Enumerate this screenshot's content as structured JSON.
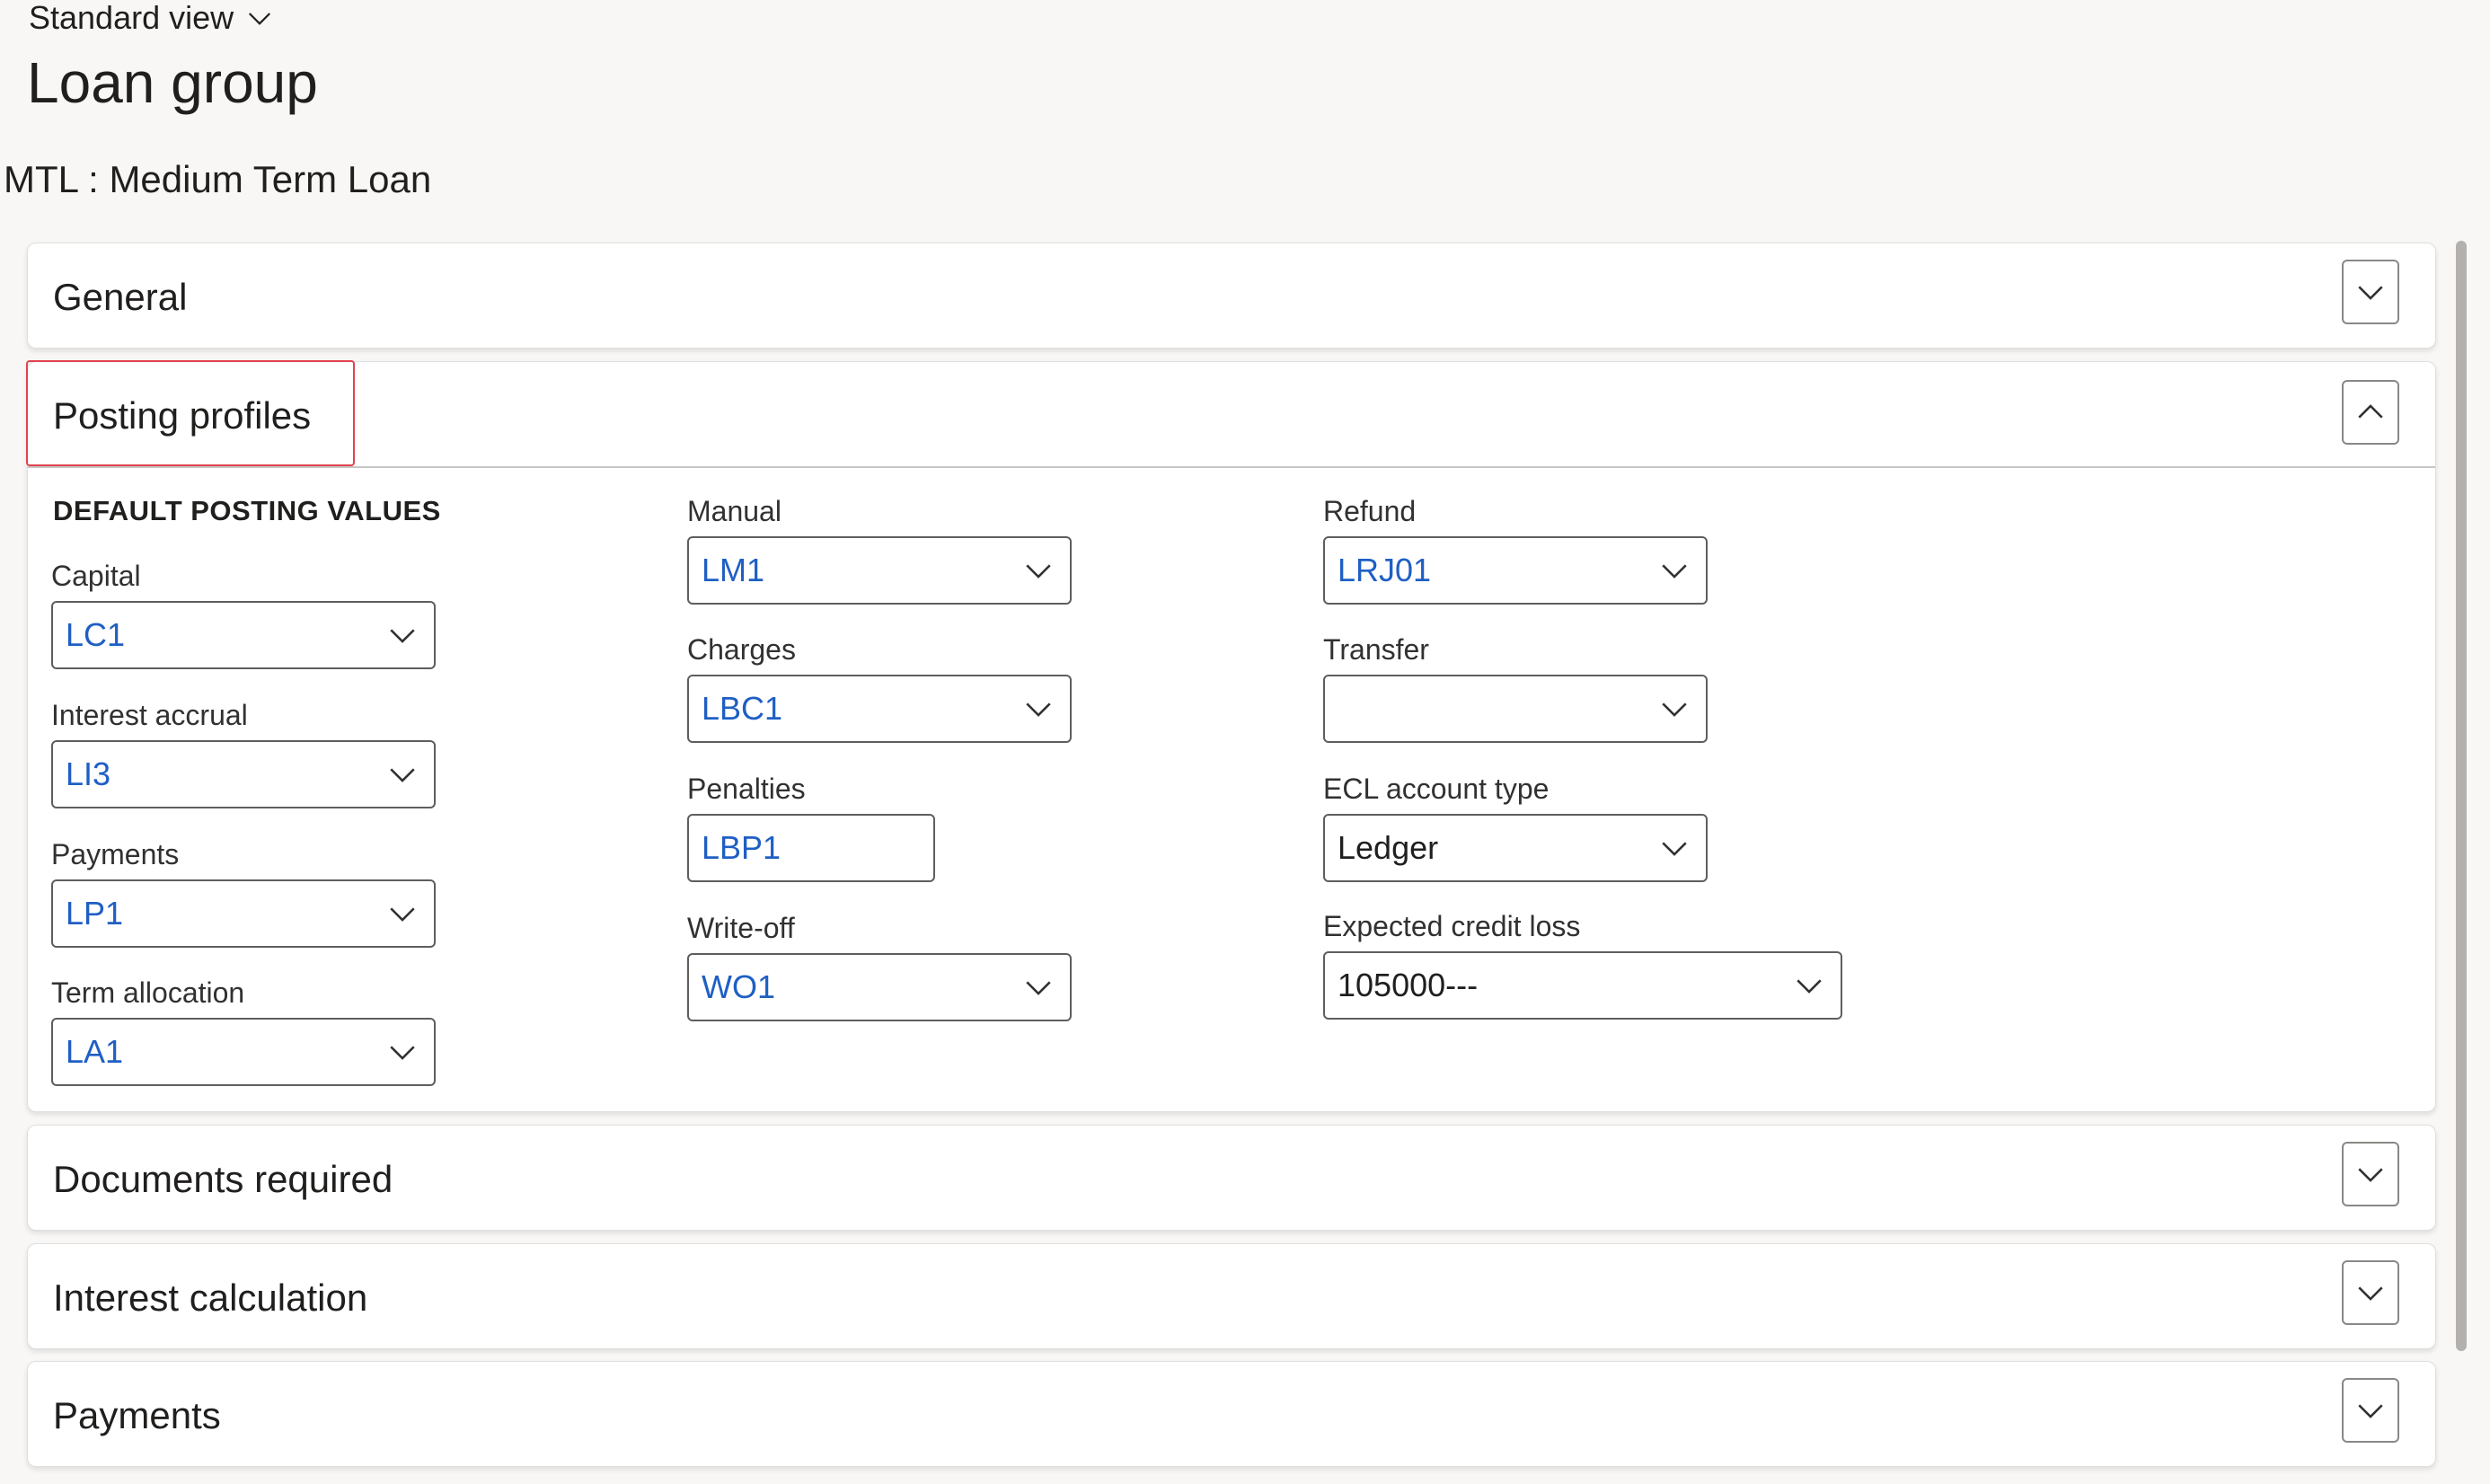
{
  "header": {
    "view_label": "Standard view",
    "page_title": "Loan group",
    "record_title": "MTL : Medium Term Loan"
  },
  "sections": {
    "general": {
      "title": "General",
      "expanded": false
    },
    "posting_profiles": {
      "title": "Posting profiles",
      "expanded": true
    },
    "documents_required": {
      "title": "Documents required",
      "expanded": false
    },
    "interest_calculation": {
      "title": "Interest calculation",
      "expanded": false
    },
    "payments": {
      "title": "Payments",
      "expanded": false
    }
  },
  "posting": {
    "group_heading": "DEFAULT POSTING VALUES",
    "fields": {
      "capital": {
        "label": "Capital",
        "value": "LC1"
      },
      "interest_accrual": {
        "label": "Interest accrual",
        "value": "LI3"
      },
      "payments": {
        "label": "Payments",
        "value": "LP1"
      },
      "term_allocation": {
        "label": "Term allocation",
        "value": "LA1"
      },
      "manual": {
        "label": "Manual",
        "value": "LM1"
      },
      "charges": {
        "label": "Charges",
        "value": "LBC1"
      },
      "penalties": {
        "label": "Penalties",
        "value": "LBP1"
      },
      "write_off": {
        "label": "Write-off",
        "value": "WO1"
      },
      "refund": {
        "label": "Refund",
        "value": "LRJ01"
      },
      "transfer": {
        "label": "Transfer",
        "value": ""
      },
      "ecl_account_type": {
        "label": "ECL account type",
        "value": "Ledger"
      },
      "expected_credit_loss": {
        "label": "Expected credit loss",
        "value": "105000---"
      }
    }
  },
  "colors": {
    "link_value": "#1f5fc4",
    "focus_outline": "#e1424f",
    "page_background": "#f8f7f6"
  },
  "icons": {
    "view_dropdown": "chevron-down-icon",
    "collapse": "chevron-up-icon",
    "expand": "chevron-down-icon"
  }
}
